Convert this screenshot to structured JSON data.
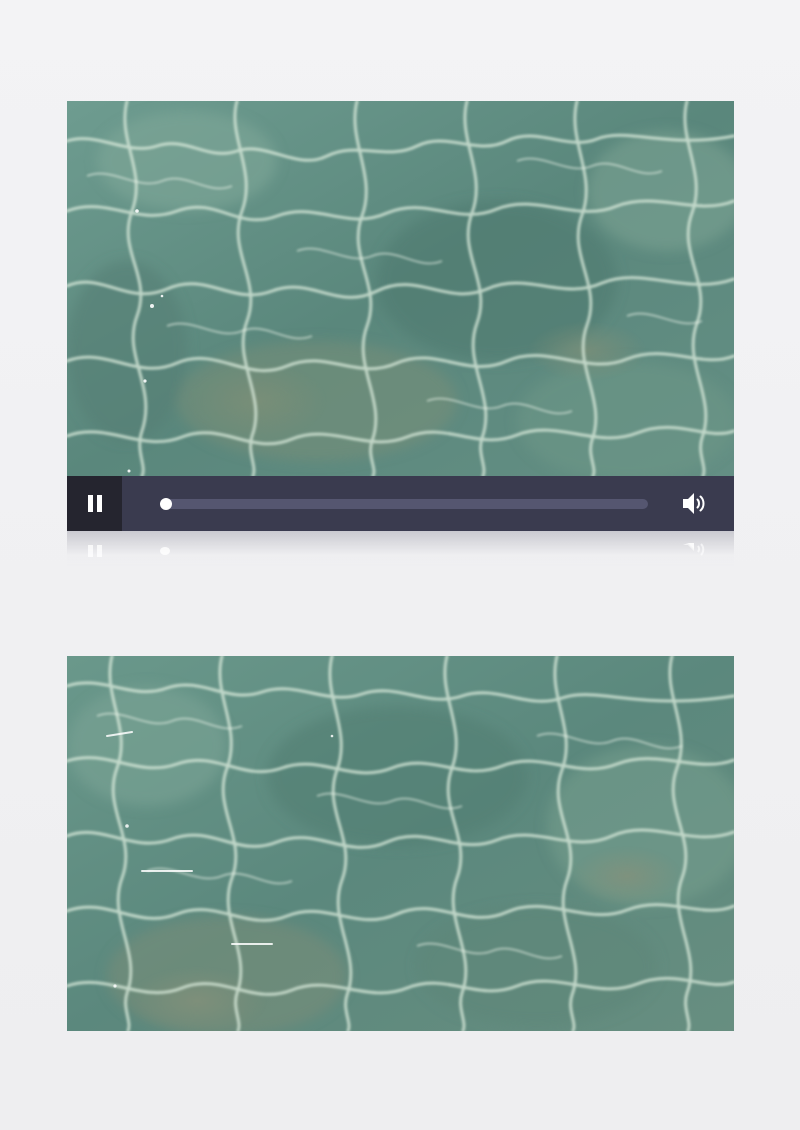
{
  "player": {
    "state": "playing",
    "progress": 0.0,
    "pause_icon": "pause-icon",
    "volume_icon": "speaker-volume-icon"
  },
  "colors": {
    "page_background": "#f0f0f2",
    "control_bar": "#3a3b4f",
    "pause_button_bg": "#25252f",
    "track": "#555670",
    "thumb": "#ffffff",
    "water_base": "#5f8a80"
  },
  "frames": [
    {
      "content": "water-ripple-video-frame"
    },
    {
      "content": "water-ripple-preview-frame"
    }
  ]
}
